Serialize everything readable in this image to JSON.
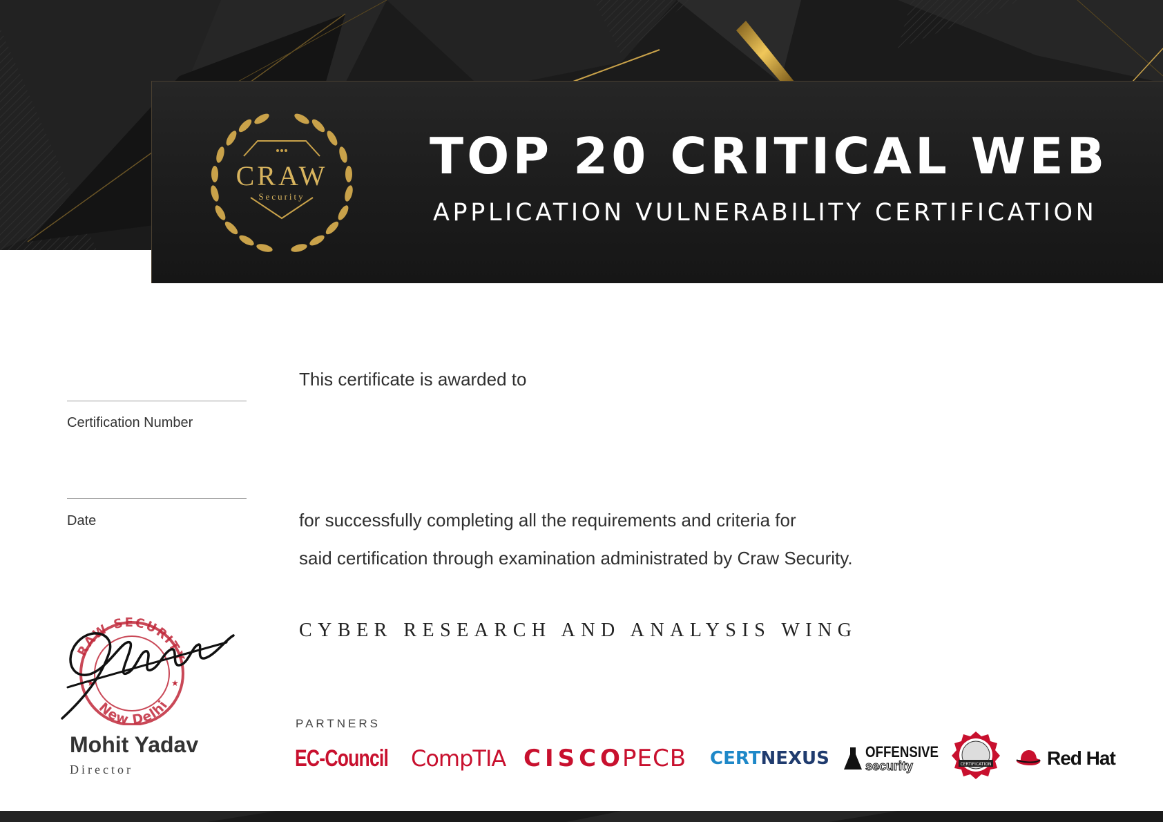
{
  "colors": {
    "gold": "#c9a24a",
    "dark": "#1c1c1c",
    "stamp_red": "#c0283a",
    "partner_red": "#c8102e",
    "certnexus_blue": "#1e88c8",
    "certnexus_navy": "#1f3b6e"
  },
  "seal": {
    "brand": "CRAW",
    "sub": "Security",
    "icon": "laurel-wreath-shield-icon"
  },
  "title": {
    "main": "TOP 20 CRITICAL WEB",
    "sub": "APPLICATION VULNERABILITY CERTIFICATION"
  },
  "fields": {
    "certification_number_label": "Certification Number",
    "date_label": "Date"
  },
  "body": {
    "awarded": "This certificate is awarded to",
    "line1": "for successfully completing all the requirements and criteria for",
    "line2": "said certification through examination administrated by Craw Security."
  },
  "tagline": "CYBER RESEARCH AND ANALYSIS WING",
  "signature": {
    "stamp_city": "New Delhi",
    "stamp_top": "RAW SECURITY",
    "name": "Mohit Yadav",
    "role": "Director"
  },
  "partners": {
    "heading": "PARTNERS",
    "logos": [
      {
        "name": "EC-Council"
      },
      {
        "name": "CompTIA"
      },
      {
        "name": "CISCO"
      },
      {
        "name": "PECB"
      },
      {
        "name_a": "CERT",
        "name_b": "NEXUS"
      },
      {
        "name_a": "OFFENSIVE",
        "name_b": "security"
      },
      {
        "badge": "CERTIFICATION"
      },
      {
        "name": "Red Hat"
      }
    ]
  }
}
